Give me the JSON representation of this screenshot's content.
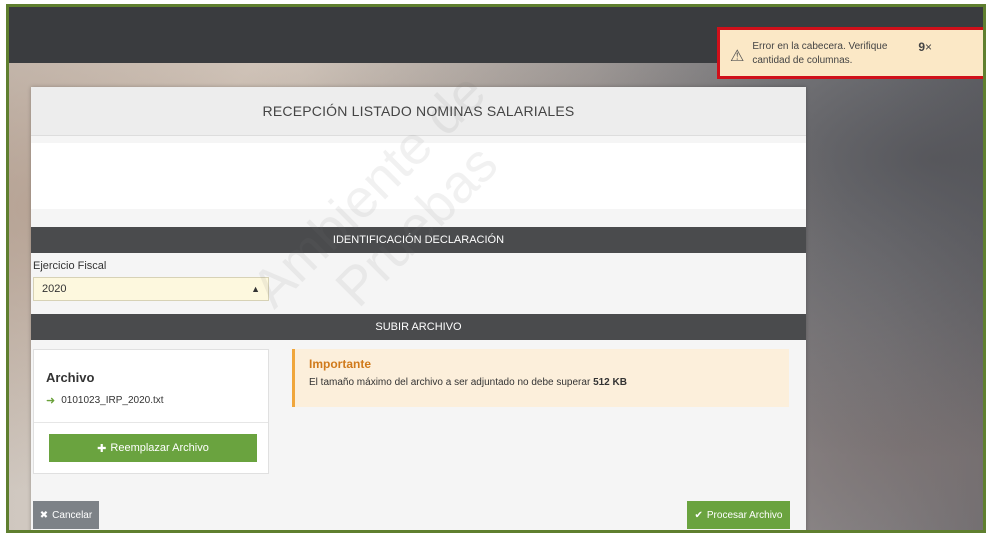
{
  "card": {
    "title": "RECEPCIÓN LISTADO NOMINAS SALARIALES"
  },
  "identificacion": {
    "section_title": "IDENTIFICACIÓN DECLARACIÓN",
    "ejercicio_label": "Ejercicio Fiscal",
    "ejercicio_value": "2020"
  },
  "subir": {
    "section_title": "SUBIR ARCHIVO",
    "archivo_title": "Archivo",
    "file_name": "0101023_IRP_2020.txt",
    "replace_button": "Reemplazar Archivo"
  },
  "notice": {
    "title": "Importante",
    "text": "El tamaño máximo del archivo a ser adjuntado no debe superar",
    "limit": "512 KB"
  },
  "actions": {
    "cancel_label": "Cancelar",
    "process_label": "Procesar Archivo"
  },
  "toast": {
    "message": "Error en la cabecera. Verifique cantidad de columnas.",
    "count": "9"
  },
  "watermark": {
    "line1": "Ambiente de",
    "line2": "Pruebas"
  },
  "icons": {
    "warning": "warning-icon",
    "close": "close-icon",
    "arrow": "arrow-right-icon",
    "plus": "plus-icon",
    "check": "check-icon",
    "times": "times-icon",
    "sort": "sort-icon"
  },
  "colors": {
    "accent_green": "#6aa33f",
    "toast_border": "#d0101a",
    "toast_bg": "#fbe8c6",
    "notice_bg": "#fcefdb",
    "section_bar": "#4a4b4d"
  }
}
